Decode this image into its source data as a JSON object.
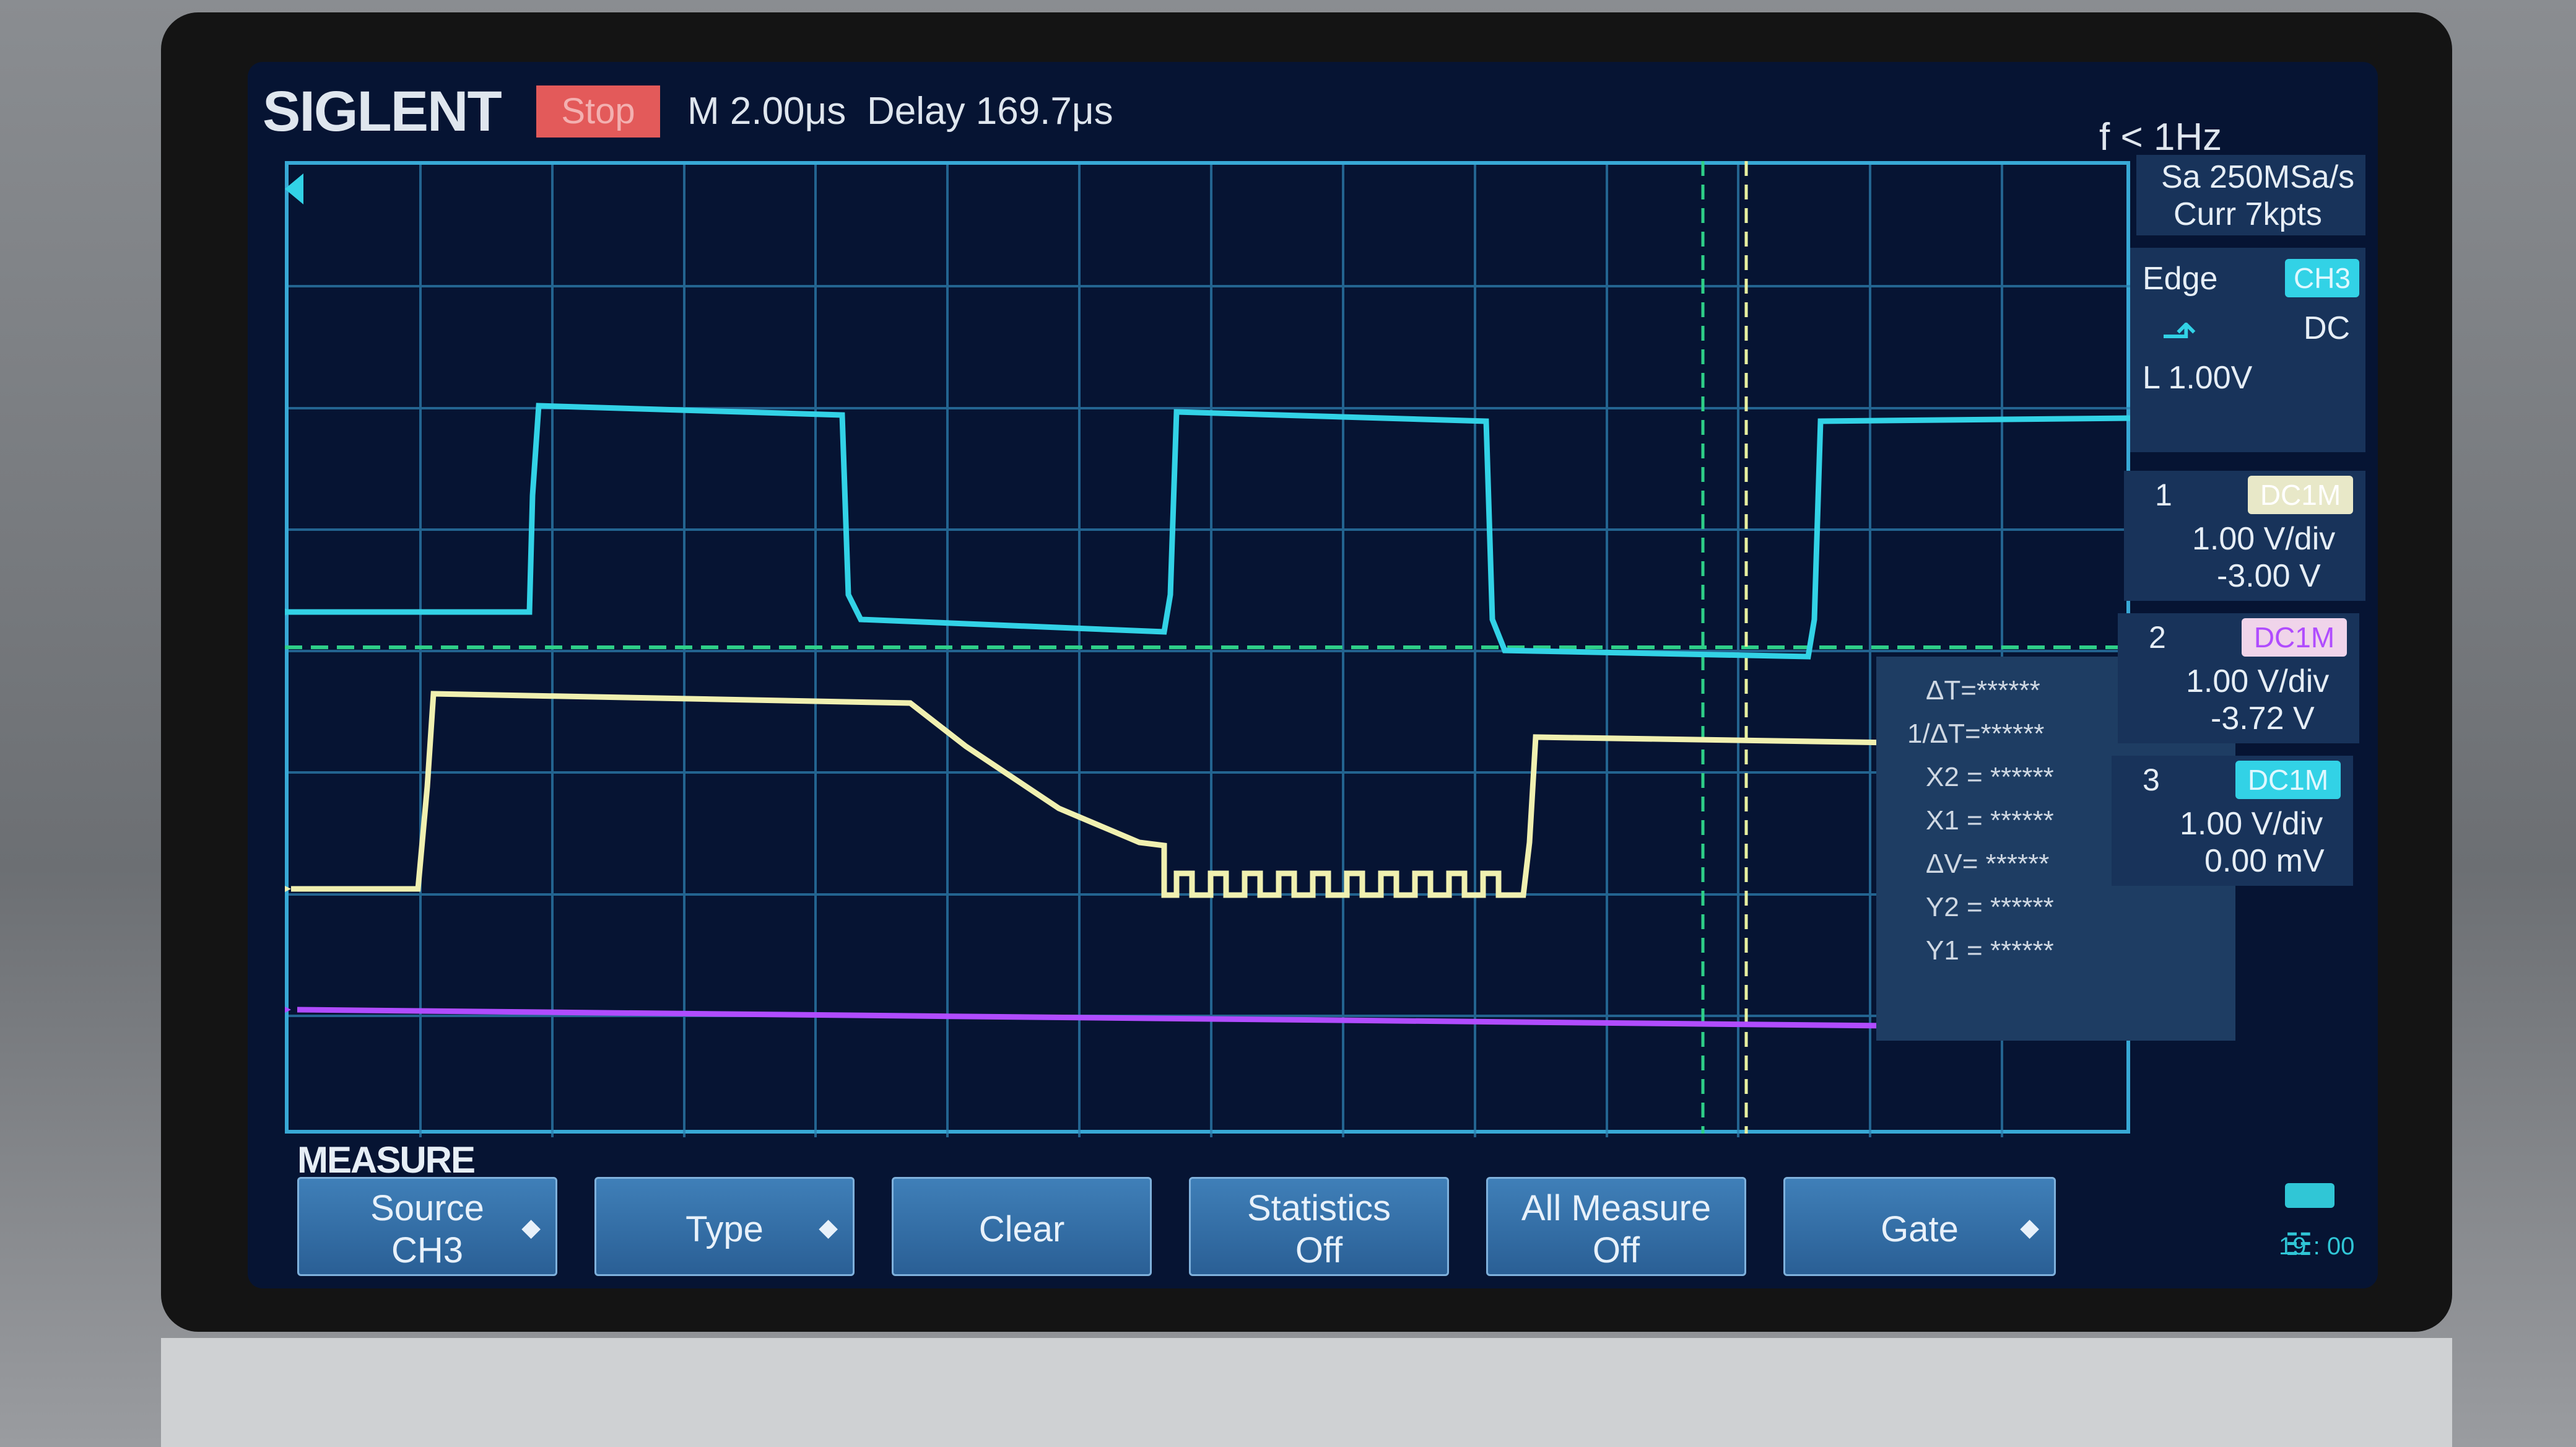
{
  "header": {
    "brand": "SIGLENT",
    "run_state": "Stop",
    "timebase": "M 2.00μs",
    "delay": "Delay 169.7μs",
    "trigger_freq": "f < 1Hz"
  },
  "acquisition": {
    "sample_rate": "Sa 250MSa/s",
    "memory": "Curr 7kpts"
  },
  "trigger": {
    "type": "Edge",
    "source": "CH3",
    "coupling": "DC",
    "slope_icon": "rising-edge-icon",
    "level": "L  1.00V"
  },
  "channels": [
    {
      "num": "1",
      "chip": "DC1M",
      "scale": "1.00 V/div",
      "offset": "-3.00 V",
      "color": "#32d2e6"
    },
    {
      "num": "2",
      "chip": "DC1M",
      "scale": "1.00 V/div",
      "offset": "-3.72 V",
      "color": "#f0f0b0"
    },
    {
      "num": "3",
      "chip": "DC1M",
      "scale": "1.00 V/div",
      "offset": "0.00 mV",
      "color": "#b04cff"
    }
  ],
  "cursor_readout": {
    "dt": "ΔT=******",
    "inv_dt": "1/ΔT=******",
    "x2": "X2 = ******",
    "x1": "X1 = ******",
    "dv": "ΔV= ******",
    "y2": "Y2 = ******",
    "y1": "Y1 = ******"
  },
  "menu": {
    "title": "MEASURE",
    "source_l1": "Source",
    "source_l2": "CH3",
    "type": "Type",
    "clear": "Clear",
    "statistics_l1": "Statistics",
    "statistics_l2": "Off",
    "all_measure_l1": "All Measure",
    "all_measure_l2": "Off",
    "gate": "Gate"
  },
  "status": {
    "time": "19 : 00"
  }
}
